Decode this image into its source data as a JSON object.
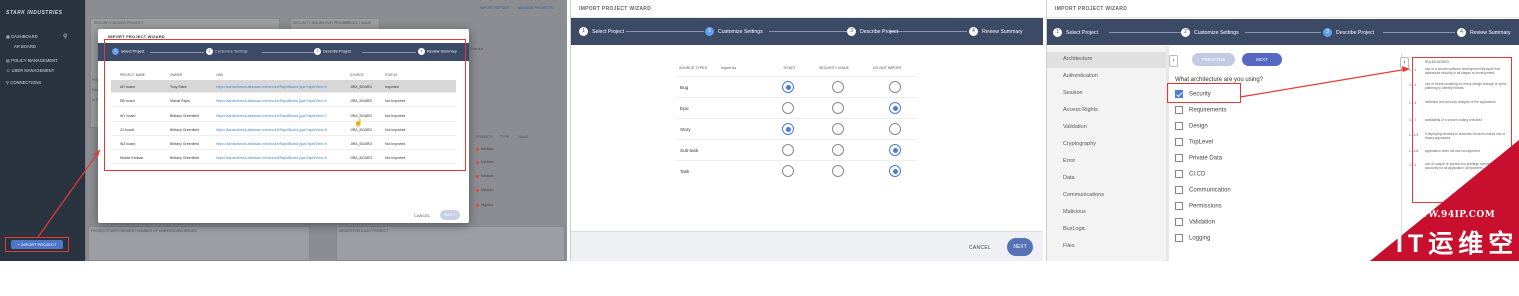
{
  "panel1": {
    "brand": "STARK INDUSTRIES",
    "sidebar": [
      {
        "icon": "dashboard-icon",
        "label": "DASHBOARD"
      },
      {
        "icon": "",
        "label": "AR BOARD"
      },
      {
        "icon": "policy-icon",
        "label": "POLICY MANAGEMENT"
      },
      {
        "icon": "user-icon",
        "label": "USER MANAGEMENT"
      },
      {
        "icon": "link-icon",
        "label": "CONNECTIONS"
      }
    ],
    "import_button": "+ IMPORT PROJECT",
    "top_links": [
      "IMPORT REPORT",
      "MANAGE PROJECTS"
    ],
    "bg_labels": {
      "card1": "SECURITY DESIGN PROJECT",
      "card2": "SECURITY ISSUES FOR PROJECT",
      "card3": "PROJECT NAME",
      "bottom_left": "PROJECTS WITH HIGHEST NUMBER OF UNRESOLVED ISSUES",
      "bottom_right": "ISSUES FOR EACH PROJECT",
      "col_headers": [
        "PRIORITY",
        "TYPE",
        "NAME"
      ],
      "side_words": [
        "Proje",
        "Dasi",
        "In Pr"
      ],
      "right_word": "Overdue"
    },
    "priorities": [
      "Medium",
      "Medium",
      "Medium",
      "Medium",
      "Highest"
    ],
    "modal": {
      "title": "IMPORT PROJECT WIZARD",
      "steps": [
        "Select Project",
        "Customize Settings",
        "Describe Project",
        "Review Summary"
      ],
      "step_numbers": [
        "1",
        "2",
        "3",
        "4"
      ],
      "columns": [
        "PROJECT NAME",
        "OWNER",
        "LINK",
        "SOURCE",
        "STATUS"
      ],
      "rows": [
        {
          "name": "AR board",
          "owner": "Tony Stark",
          "link": "https://aardsoftwork.atlassian.net/secure/RapidBoard.jspa?rapidView=3",
          "source": "JIRA_BOARD",
          "status": "Imported"
        },
        {
          "name": "RB board",
          "owner": "Michal Papis",
          "link": "https://aardsoftwork.atlassian.net/secure/RapidBoard.jspa?rapidView=5",
          "source": "JIRA_BOARD",
          "status": "Not Imported"
        },
        {
          "name": "WY board",
          "owner": "Brittany Greenfield",
          "link": "https://aardsoftwork.atlassian.net/secure/RapidBoard.jspa?rapidView=7",
          "source": "JIRA_BOARD",
          "status": "Not Imported"
        },
        {
          "name": "ZJ board",
          "owner": "Brittany Greenfield",
          "link": "https://aardsoftwork.atlassian.net/secure/RapidBoard.jspa?rapidView=8",
          "source": "JIRA_BOARD",
          "status": "Not Imported"
        },
        {
          "name": "WZ board",
          "owner": "Brittany Greenfield",
          "link": "https://aardsoftwork.atlassian.net/secure/RapidBoard.jspa?rapidView=9",
          "source": "JIRA_BOARD",
          "status": "Not Imported"
        },
        {
          "name": "Mobile Kanban",
          "owner": "Brittany Greenfield",
          "link": "https://aardsoftwork.atlassian.net/secure/RapidBoard.jspa?rapidView=6",
          "source": "JIRA_BOARD",
          "status": "Not Imported"
        }
      ],
      "cancel": "CANCEL",
      "next": "NEXT"
    }
  },
  "panel2": {
    "title": "IMPORT PROJECT WIZARD",
    "steps": [
      "Select Project",
      "Customize Settings",
      "Describe Project",
      "Review Summary"
    ],
    "step_numbers": [
      "1",
      "2",
      "3",
      "4"
    ],
    "active_step": 2,
    "columns": [
      "SOURCE TYPES",
      "Import As",
      "TICKET",
      "SECURITY ISSUE",
      "DO NOT IMPORT"
    ],
    "rows": [
      {
        "type": "Bug",
        "selected": "ticket"
      },
      {
        "type": "Epic",
        "selected": "do_not_import"
      },
      {
        "type": "Story",
        "selected": "ticket"
      },
      {
        "type": "Sub-task",
        "selected": "do_not_import"
      },
      {
        "type": "Task",
        "selected": "do_not_import"
      }
    ],
    "cancel": "CANCEL",
    "next": "NEXT"
  },
  "panel3": {
    "title": "IMPORT PROJECT WIZARD",
    "steps": [
      "Select Project",
      "Customize Settings",
      "Describe Project",
      "Review Summary"
    ],
    "step_numbers": [
      "1",
      "2",
      "3",
      "4"
    ],
    "active_step": 3,
    "categories": [
      "Architecture",
      "Authentication",
      "Session",
      "Access Rights",
      "Validation",
      "Cryptography",
      "Error",
      "Data",
      "Communications",
      "Malicious",
      "BusLogic",
      "Files"
    ],
    "active_category": "Architecture",
    "previous": "PREVIOUS",
    "next": "NEXT",
    "question": "What architecture are you using?",
    "options": [
      {
        "label": "Security",
        "checked": true
      },
      {
        "label": "Requirements",
        "checked": false
      },
      {
        "label": "Design",
        "checked": false
      },
      {
        "label": "TopLevel",
        "checked": false
      },
      {
        "label": "Private Data",
        "checked": false
      },
      {
        "label": "CI.CD",
        "checked": false
      },
      {
        "label": "Communication",
        "checked": false
      },
      {
        "label": "Permissions",
        "checked": false
      },
      {
        "label": "Validation",
        "checked": false
      },
      {
        "label": "Logging",
        "checked": false
      }
    ],
    "rules_header": "RULES ADDED",
    "rules": [
      {
        "num": "1.1.1",
        "text": "use of a secure software development lifecycle that addresses security in all stages of development"
      },
      {
        "num": "1.1.2",
        "text": "use of threat modeling for every design change or sprint planning to identify threats"
      },
      {
        "num": "1.1.6",
        "text": "definition and security analysis of the application"
      },
      {
        "num": "1.1.7",
        "text": "availability of a secure coding checklist"
      },
      {
        "num": "1.14.5",
        "text": "if deploying binaries to untrusted devices makes use of binary signatures"
      },
      {
        "num": "1.14.6",
        "text": "application does not use unsupported"
      },
      {
        "num": "1.5.1",
        "text": "use of unique or special low-privilege operating system accounts for all application components"
      }
    ]
  },
  "watermark": {
    "line1": "WWW.94IP.COM",
    "line2": "IT运维空间"
  }
}
